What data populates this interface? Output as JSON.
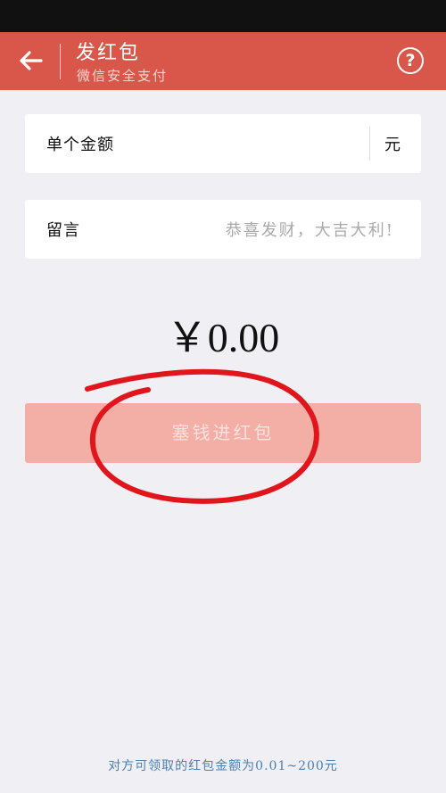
{
  "header": {
    "title": "发红包",
    "subtitle": "微信安全支付",
    "back_icon": "back-arrow-icon",
    "help_icon": "help-icon",
    "help_glyph": "?"
  },
  "amount_field": {
    "label": "单个金额",
    "value": "",
    "unit": "元"
  },
  "message_field": {
    "label": "留言",
    "placeholder": "恭喜发财，大吉大利!"
  },
  "total": "￥0.00",
  "send_button": {
    "label": "塞钱进红包"
  },
  "footer_note": "对方可领取的红包金额为0.01~200元",
  "colors": {
    "header_bg": "#d9574a",
    "button_bg": "#f3aea6",
    "annotation": "#e0161c",
    "footer_text": "#4a7fb5"
  }
}
